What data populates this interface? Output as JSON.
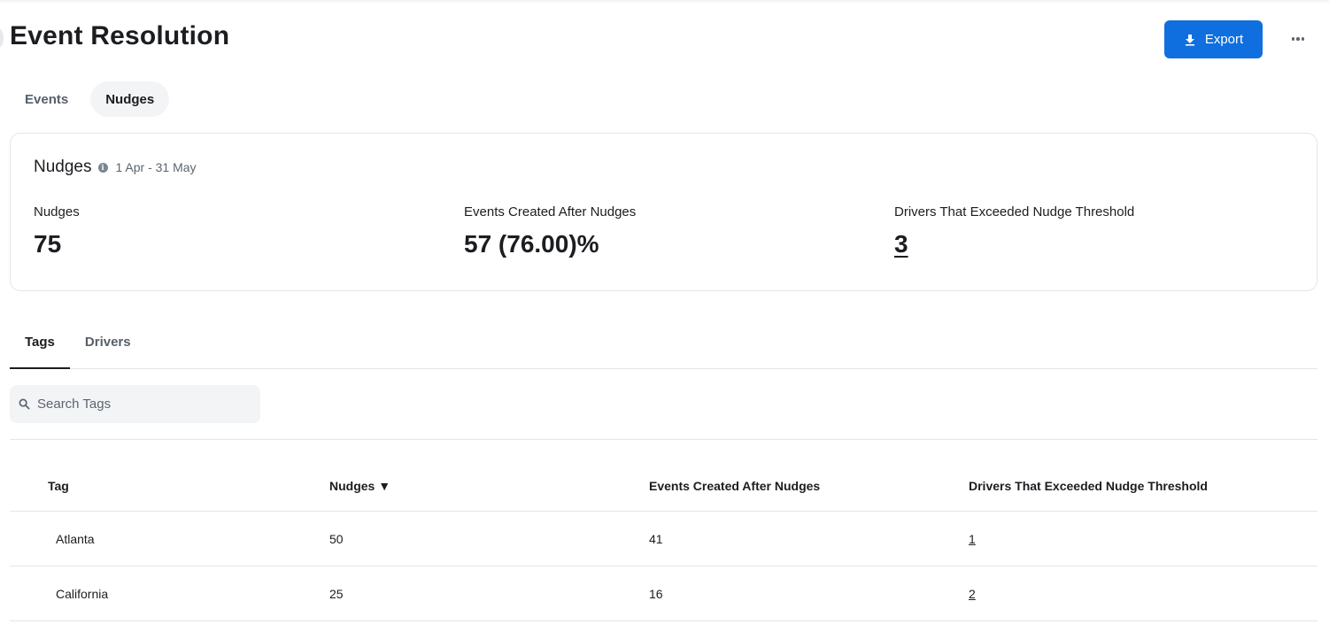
{
  "page": {
    "title": "Event Resolution"
  },
  "actions": {
    "export_label": "Export",
    "export_icon": "download-icon",
    "more_icon": "more-horizontal-icon"
  },
  "view_tabs": [
    {
      "label": "Events",
      "active": false
    },
    {
      "label": "Nudges",
      "active": true
    }
  ],
  "summary": {
    "title": "Nudges",
    "info_icon": "info-icon",
    "date_range": "1 Apr - 31 May",
    "kpis": [
      {
        "label": "Nudges",
        "value": "75",
        "link": false
      },
      {
        "label": "Events Created After Nudges",
        "value": "57 (76.00)%",
        "link": false
      },
      {
        "label": "Drivers That Exceeded Nudge Threshold",
        "value": "3",
        "link": true
      }
    ]
  },
  "sub_tabs": [
    {
      "label": "Tags",
      "active": true
    },
    {
      "label": "Drivers",
      "active": false
    }
  ],
  "search": {
    "placeholder": "Search Tags",
    "value": "",
    "icon": "search-icon"
  },
  "table": {
    "columns": [
      "Tag",
      "Nudges ▼",
      "Events Created After Nudges",
      "Drivers That Exceeded Nudge Threshold"
    ],
    "sort": {
      "column": "Nudges",
      "direction": "descending"
    },
    "rows": [
      {
        "tag": "Atlanta",
        "nudges": "50",
        "events": "41",
        "drivers": "1"
      },
      {
        "tag": "California",
        "nudges": "25",
        "events": "16",
        "drivers": "2"
      }
    ]
  }
}
